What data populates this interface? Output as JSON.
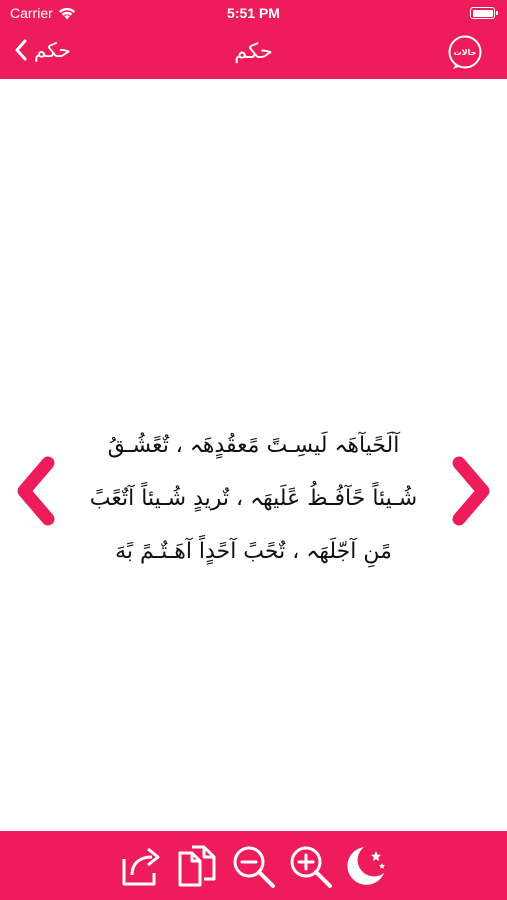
{
  "status": {
    "carrier": "Carrier",
    "time": "5:51 PM"
  },
  "nav": {
    "back_label": "حكم",
    "title": "حكم",
    "app_icon_text": "حالات"
  },
  "quote": {
    "lines": [
      "آلَحًيآهَہ لَيسِـتً مًعقُدٍهَہ ، تٌعًشُـقُ",
      "شُـيئاً حًآفُـظُ عًلَيهَہ ، تٌريدٍ شُـيئاً آتٌعًبً",
      "مًنِ آجّلَهَہ ، تٌحًبً آحًدٍاً آهَـتٌـمً بًهَ"
    ]
  },
  "toolbar": {
    "share_icon": "share-icon",
    "copy_icon": "copy-icon",
    "zoom_out_icon": "zoom-out-icon",
    "zoom_in_icon": "zoom-in-icon",
    "night_mode_icon": "moon-stars-icon"
  },
  "colors": {
    "brand": "#ee1c5a",
    "text": "#111111",
    "background": "#ffffff"
  }
}
